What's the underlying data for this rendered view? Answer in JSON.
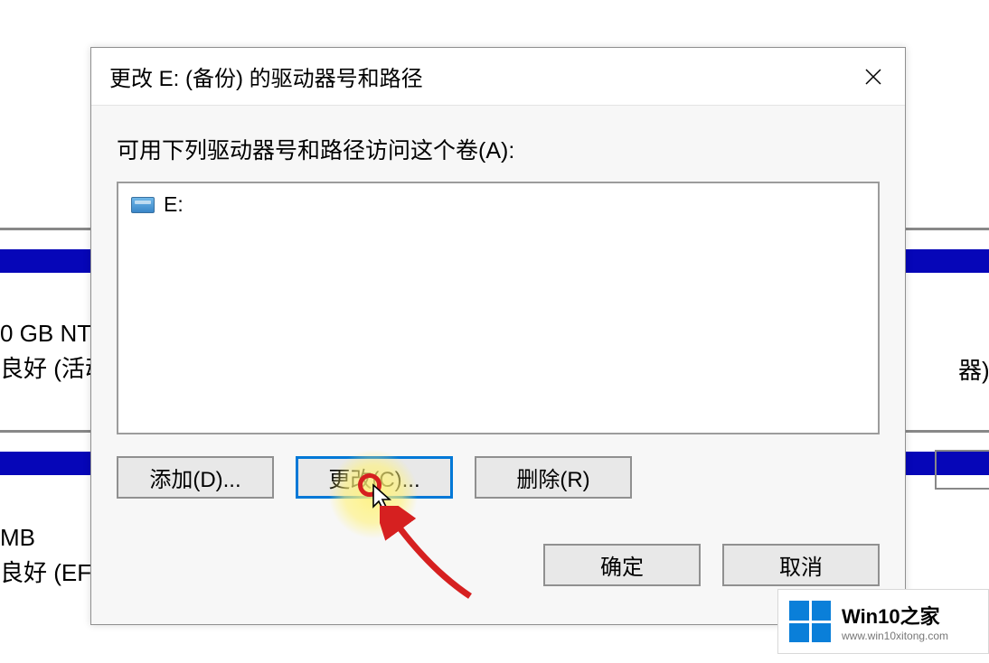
{
  "dialog": {
    "title": "更改 E: (备份) 的驱动器号和路径",
    "description": "可用下列驱动器号和路径访问这个卷(A):",
    "list_item": "E:",
    "buttons": {
      "add": "添加(D)...",
      "change": "更改(C)...",
      "remove": "删除(R)",
      "ok": "确定",
      "cancel": "取消"
    }
  },
  "background": {
    "partition1_line1": "0 GB NT",
    "partition1_line2": "良好 (活动",
    "partition2_line1": "MB",
    "partition2_line2": "良好 (EFI 系",
    "right_fragment": "器)"
  },
  "watermark": {
    "title": "Win10之家",
    "url": "www.win10xitong.com"
  }
}
